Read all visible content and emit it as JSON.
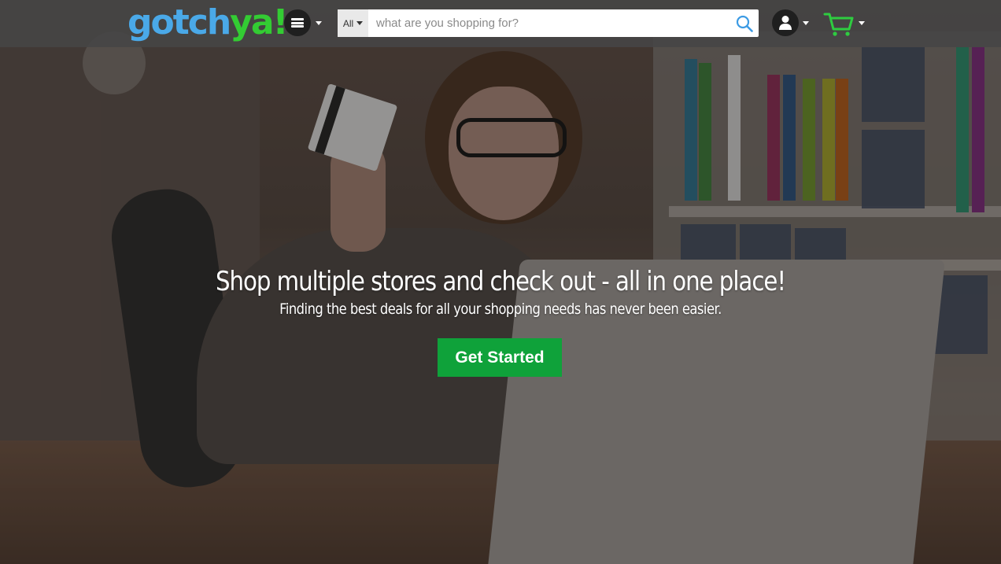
{
  "header": {
    "logo_part1": "gotch",
    "logo_part2": "ya!",
    "search": {
      "category": "All",
      "placeholder": "what are you shopping for?",
      "value": ""
    }
  },
  "hero": {
    "headline": "Shop multiple stores and check out - all in one place!",
    "subline": "Finding the best deals for all your shopping needs has never been easier.",
    "cta_label": "Get Started"
  },
  "icons": {
    "menu": "hamburger-icon",
    "search": "search-icon",
    "account": "user-icon",
    "cart": "cart-icon",
    "dropdown": "chevron-down-icon"
  },
  "colors": {
    "brand_blue": "#4aa9e8",
    "brand_green": "#33cc33",
    "cta_green": "#0fa23a",
    "search_icon": "#3c9be4"
  }
}
